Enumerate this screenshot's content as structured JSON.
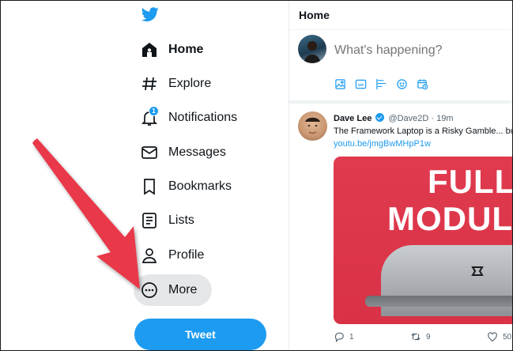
{
  "nav": {
    "logo": "twitter-bird-icon",
    "items": [
      {
        "label": "Home",
        "icon": "home-icon"
      },
      {
        "label": "Explore",
        "icon": "hashtag-icon"
      },
      {
        "label": "Notifications",
        "icon": "bell-icon",
        "badge": "1"
      },
      {
        "label": "Messages",
        "icon": "envelope-icon"
      },
      {
        "label": "Bookmarks",
        "icon": "bookmark-icon"
      },
      {
        "label": "Lists",
        "icon": "list-icon"
      },
      {
        "label": "Profile",
        "icon": "person-icon"
      },
      {
        "label": "More",
        "icon": "more-circle-icon"
      }
    ],
    "tweet_button": "Tweet"
  },
  "main": {
    "title": "Home",
    "compose": {
      "placeholder": "What's happening?",
      "icons": [
        "image-icon",
        "gif-icon",
        "poll-icon",
        "emoji-icon",
        "schedule-icon"
      ]
    },
    "tweet": {
      "name": "Dave Lee",
      "handle": "@Dave2D",
      "separator": "·",
      "time": "19m",
      "text": "The Framework Laptop is a Risky Gamble... but",
      "link": "youtu.be/jmgBwMHpP1w",
      "media": {
        "line1": "FULL",
        "line2": "MODUL"
      },
      "actions": {
        "replies": "1",
        "retweets": "9",
        "likes": "50"
      }
    }
  },
  "colors": {
    "accent": "#1d9bf0",
    "arrow": "#e8384a",
    "hover_bg": "#e4e6e8"
  }
}
